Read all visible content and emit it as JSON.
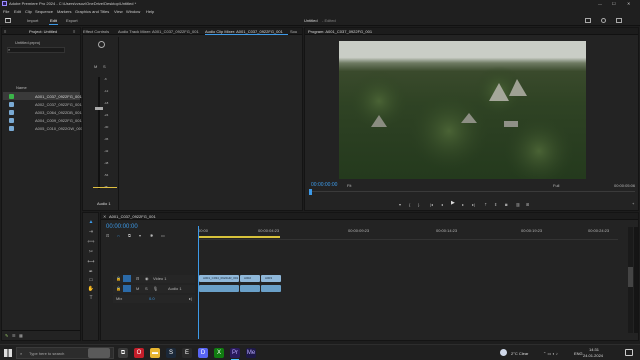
{
  "app": {
    "title": "Adobe Premiere Pro 2024 - C:\\Users\\rvsoz\\OneDrive\\Desktop\\Untitled *"
  },
  "menu": [
    "File",
    "Edit",
    "Clip",
    "Sequence",
    "Markers",
    "Graphics and Titles",
    "View",
    "Window",
    "Help"
  ],
  "workspace": {
    "tabs": [
      "Import",
      "Edit",
      "Export"
    ],
    "active": "Edit",
    "project_title": "Untitled",
    "project_state": "- Edited"
  },
  "project_panel": {
    "tab": "Project: Untitled",
    "file": "Untitled.prproj",
    "column_name": "Name",
    "items": [
      "A001_C037_0922FG_001",
      "A002_C037_0922FG_001.mov",
      "A003_C064_0922DB_001.mov",
      "A004_C009_0922FG_001.mov",
      "A005_C010_0922GW_001.mov"
    ]
  },
  "source_tabs": [
    "Effect Controls",
    "Audio Track Mixer: A001_C037_0922FG_001",
    "Audio Clip Mixer: A001_C037_0922FG_001",
    "Sou"
  ],
  "program": {
    "tab": "Program: A001_C037_0922FG_001",
    "timecode": "00:00:00:00",
    "fit": "Fit",
    "quality": "Full",
    "duration": "00:00:05:06"
  },
  "meter_scale": [
    "-6",
    "-12",
    "-18",
    "-24",
    "-30",
    "-36",
    "-42",
    "-48",
    "-54",
    "dB"
  ],
  "audio_label": "Audio 1",
  "timeline": {
    "tab": "A001_C037_0922FG_001",
    "timecode": "00:00:00:00",
    "ruler": [
      "00:00",
      "00:00:04:23",
      "00:00:09:23",
      "00:00:14:23",
      "00:00:19:23",
      "00:00:24:23"
    ],
    "tracks": [
      {
        "id": "V1",
        "name": "Video 1"
      },
      {
        "id": "A1",
        "name": "Audio 1"
      },
      {
        "id": "Mix",
        "name": ""
      }
    ],
    "mix_value": "0.0",
    "clips": [
      "A001_C034_0922HR_001",
      "A002",
      "A003"
    ]
  },
  "taskbar": {
    "search_placeholder": "Type here to search",
    "weather": "2°C Clear",
    "lang": "ENG",
    "time": "14:31",
    "date": "24.01.2024"
  }
}
